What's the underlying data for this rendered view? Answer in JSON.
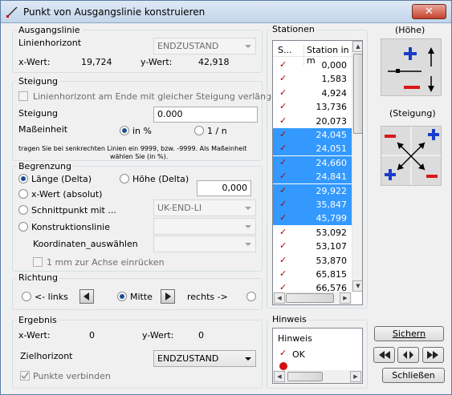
{
  "window": {
    "title": "Punkt von Ausgangslinie konstruieren",
    "close_label": "✕"
  },
  "ausgangslinie": {
    "title": "Ausgangslinie",
    "horizont_label": "Linienhorizont",
    "horizont_value": "ENDZUSTAND",
    "x_label": "x-Wert:",
    "x_value": "19,724",
    "y_label": "y-Wert:",
    "y_value": "42,918"
  },
  "steigung": {
    "title": "Steigung",
    "checkbox_label": "Linienhorizont am Ende mit gleicher Steigung verlängern",
    "steigung_label": "Steigung",
    "steigung_value": "0.000",
    "masseinheit_label": "Maßeinheit",
    "opt_percent": "in %",
    "opt_ratio": "1 / n",
    "hint_line1": "tragen Sie bei senkrechten Linien ein 9999, bzw. -9999. Als Maßeinheit",
    "hint_line2": "wählen Sie (in %)."
  },
  "begrenzung": {
    "title": "Begrenzung",
    "opt_laenge": "Länge (Delta)",
    "opt_hoehe": "Höhe (Delta)",
    "delta_value": "0,000",
    "opt_xwert": "x-Wert (absolut)",
    "opt_schnitt": "Schnittpunkt mit ...",
    "schnitt_value": "UK-END-LI",
    "opt_konstruktion": "Konstruktionslinie",
    "konstruktion_value": "",
    "koord_label": "Koordinaten_auswählen",
    "koord_value": "",
    "achse_label": "1 mm zur Achse einrücken"
  },
  "richtung": {
    "title": "Richtung",
    "opt_links": "<- links",
    "opt_mitte": "Mitte",
    "opt_rechts": "rechts ->"
  },
  "ergebnis": {
    "title": "Ergebnis",
    "x_label": "x-Wert:",
    "x_value": "0",
    "y_label": "y-Wert:",
    "y_value": "0",
    "ziel_label": "Zielhorizont",
    "ziel_value": "ENDZUSTAND",
    "punkte_label": "Punkte verbinden"
  },
  "stationen": {
    "title": "Stationen",
    "col_s": "S...",
    "col_station": "Station in m",
    "rows": [
      {
        "v": "0,000",
        "sel": false
      },
      {
        "v": "1,583",
        "sel": false
      },
      {
        "v": "4,924",
        "sel": false
      },
      {
        "v": "13,736",
        "sel": false
      },
      {
        "v": "20,073",
        "sel": false
      },
      {
        "v": "24,045",
        "sel": true
      },
      {
        "v": "24,051",
        "sel": true
      },
      {
        "v": "24,660",
        "sel": true
      },
      {
        "v": "24,841",
        "sel": true
      },
      {
        "v": "29,922",
        "sel": true
      },
      {
        "v": "35,847",
        "sel": true
      },
      {
        "v": "45,799",
        "sel": true
      },
      {
        "v": "53,092",
        "sel": false
      },
      {
        "v": "53,107",
        "sel": false
      },
      {
        "v": "53,870",
        "sel": false
      },
      {
        "v": "65,815",
        "sel": false
      },
      {
        "v": "66,576",
        "sel": false
      }
    ]
  },
  "hinweis": {
    "title": "Hinweis",
    "header": "Hinweis",
    "row1": "OK"
  },
  "right": {
    "hoehe_label": "(Höhe)",
    "steigung_label": "(Steigung)",
    "sichern_label": "Sichern",
    "schliessen_label": "Schließen"
  },
  "colors": {
    "selection": "#3399ff",
    "tick": "#b00000",
    "icon_blue": "#1a3cc8",
    "icon_red": "#d81818"
  }
}
